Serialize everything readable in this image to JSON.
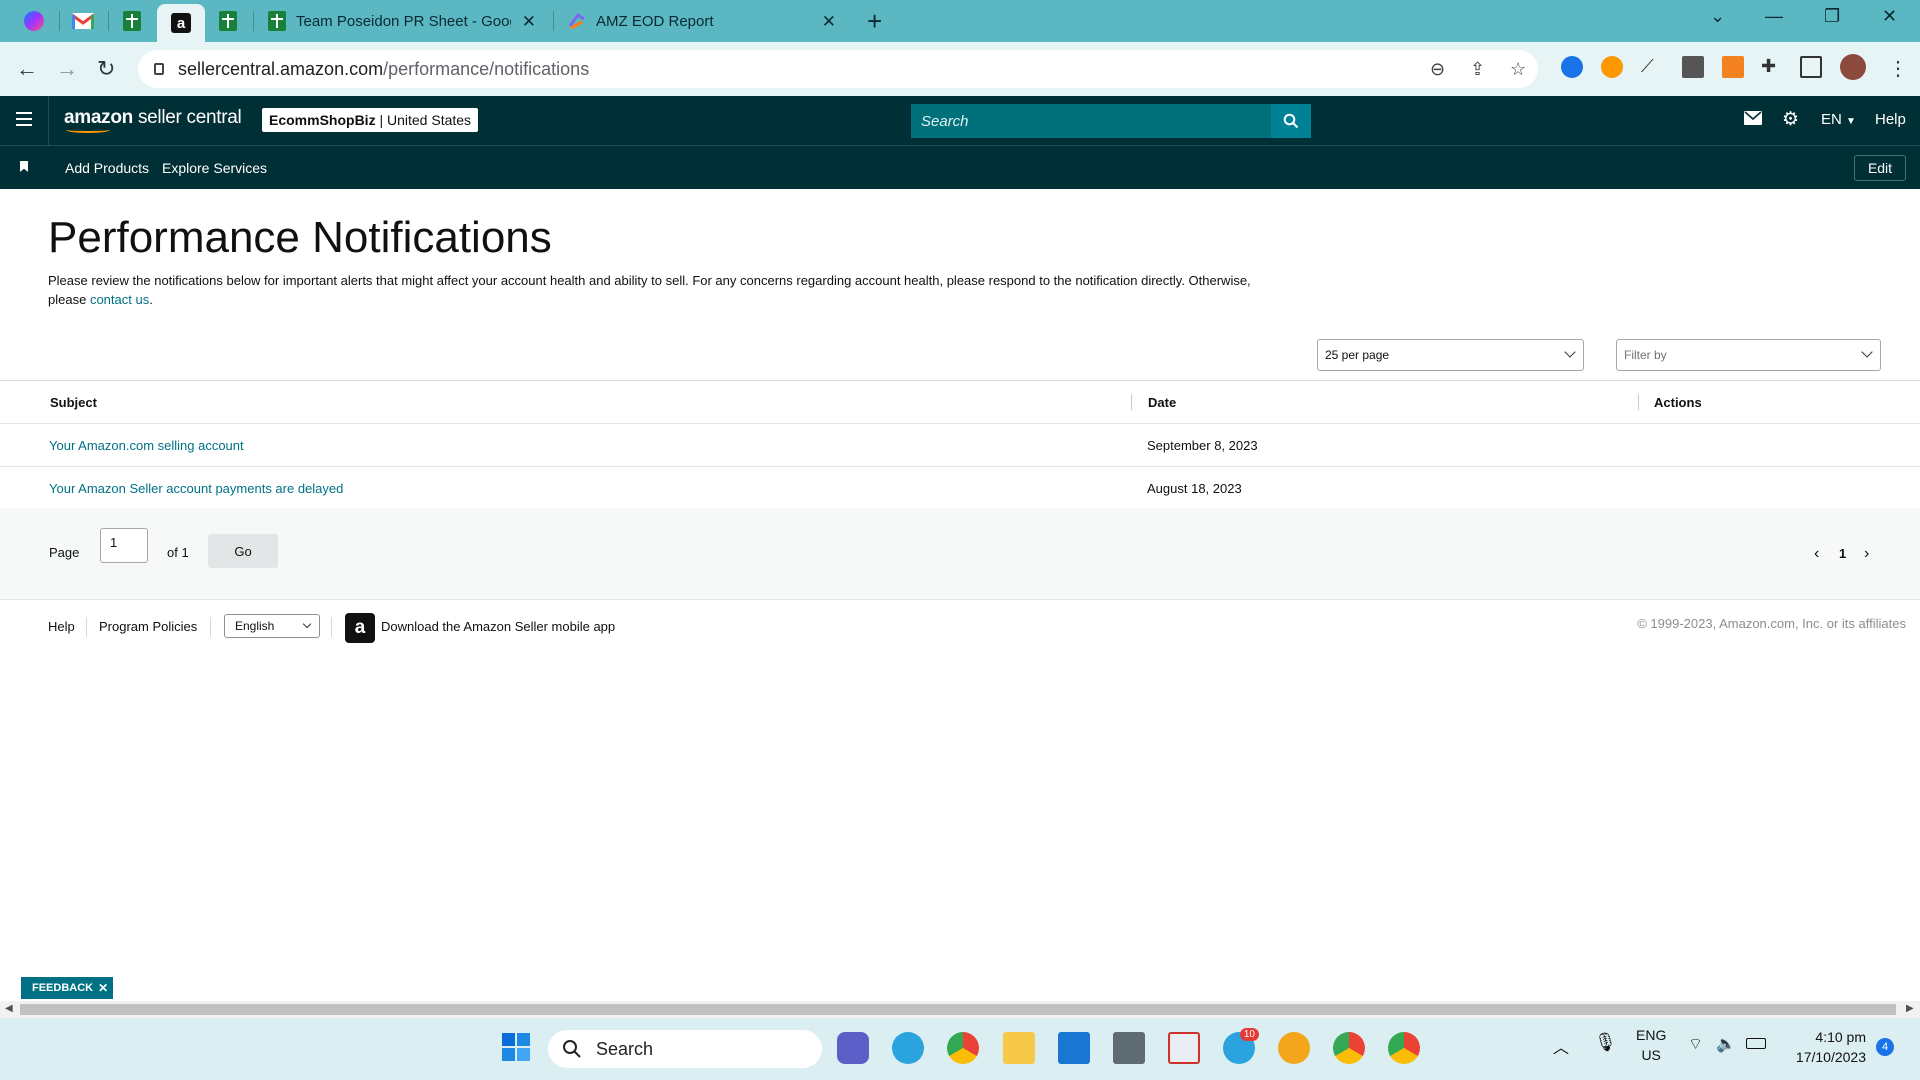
{
  "browser": {
    "tabs": [
      {
        "title": "Team Poseidon PR Sheet - Goog"
      },
      {
        "title": "AMZ EOD Report"
      }
    ],
    "url_host": "sellercentral.amazon.com",
    "url_path": "/performance/notifications"
  },
  "header": {
    "logo_brand": "amazon",
    "logo_product": "seller central",
    "store_name": "EcommShopBiz",
    "store_region": "United States",
    "search_placeholder": "Search",
    "language": "EN",
    "help": "Help"
  },
  "subnav": {
    "items": [
      "Add Products",
      "Explore Services"
    ],
    "edit": "Edit"
  },
  "page": {
    "title": "Performance Notifications",
    "description": "Please review the notifications below for important alerts that might affect your account health and ability to sell. For any concerns regarding account health, please respond to the notification directly. Otherwise, please",
    "contact_link": "contact us",
    "per_page": "25 per page",
    "filter_placeholder": "Filter by"
  },
  "table": {
    "columns": [
      "Subject",
      "Date",
      "Actions"
    ],
    "rows": [
      {
        "subject": "Your Amazon.com selling account",
        "date": "September 8, 2023",
        "actions": ""
      },
      {
        "subject": "Your Amazon Seller account payments are delayed",
        "date": "August 18, 2023",
        "actions": ""
      }
    ]
  },
  "pagination": {
    "page_label": "Page",
    "current_page": "1",
    "of_label": "of 1",
    "go": "Go",
    "page_number": "1"
  },
  "footer": {
    "help": "Help",
    "program_policies": "Program Policies",
    "language": "English",
    "app_text": "Download the Amazon Seller mobile app",
    "copyright": "© 1999-2023, Amazon.com, Inc. or its affiliates"
  },
  "feedback": "FEEDBACK",
  "taskbar": {
    "search": "Search",
    "lang_line1": "ENG",
    "lang_line2": "US",
    "time": "4:10 pm",
    "date": "17/10/2023",
    "notification_count": "4",
    "telegram_badge": "10"
  }
}
